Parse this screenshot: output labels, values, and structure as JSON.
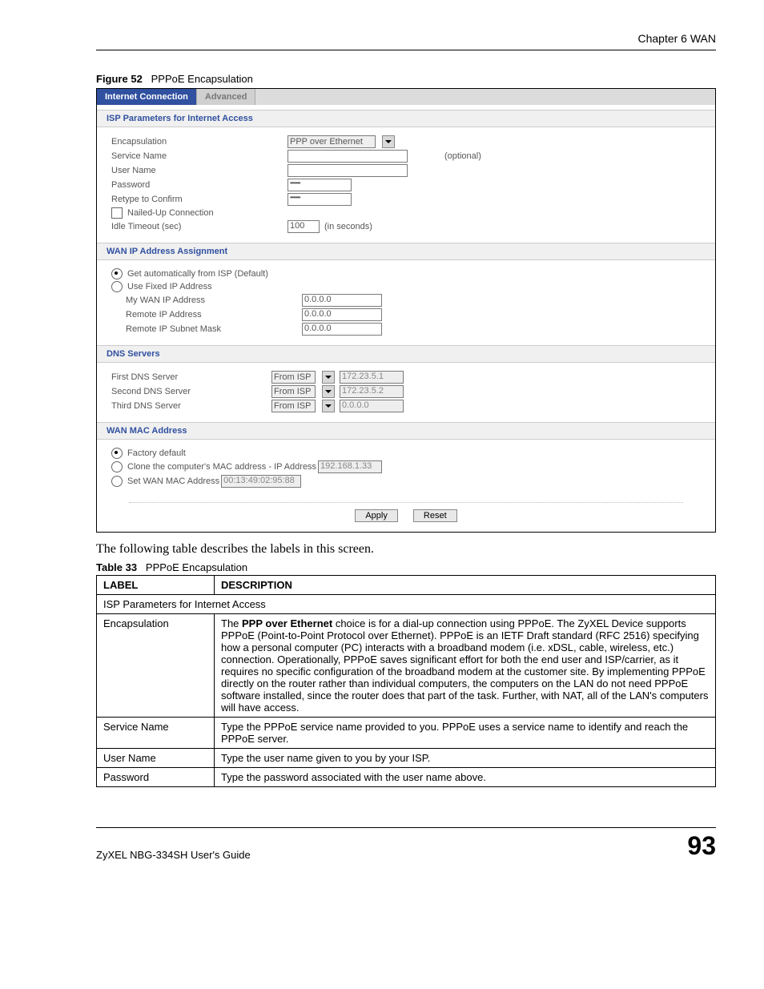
{
  "header": {
    "chapter": "Chapter 6 WAN"
  },
  "figure": {
    "label": "Figure 52",
    "title": "PPPoE Encapsulation"
  },
  "ui": {
    "tabs": {
      "active": "Internet Connection",
      "inactive": "Advanced"
    },
    "sections": {
      "isp": "ISP Parameters for Internet Access",
      "wanip": "WAN IP Address Assignment",
      "dns": "DNS Servers",
      "mac": "WAN MAC Address"
    },
    "isp": {
      "encapsulation_label": "Encapsulation",
      "encapsulation_value": "PPP over Ethernet",
      "service_name_label": "Service Name",
      "service_name_value": "",
      "service_name_hint": "(optional)",
      "user_name_label": "User Name",
      "user_name_value": "",
      "password_label": "Password",
      "password_value": "•••••••",
      "retype_label": "Retype to Confirm",
      "retype_value": "•••••••",
      "nailed_up_label": "Nailed-Up Connection",
      "idle_timeout_label": "Idle Timeout (sec)",
      "idle_timeout_value": "100",
      "idle_timeout_hint": "(in seconds)"
    },
    "wanip": {
      "auto_label": "Get automatically from ISP (Default)",
      "fixed_label": "Use Fixed IP Address",
      "my_wan_label": "My WAN IP Address",
      "my_wan_value": "0.0.0.0",
      "remote_ip_label": "Remote IP Address",
      "remote_ip_value": "0.0.0.0",
      "remote_subnet_label": "Remote IP Subnet Mask",
      "remote_subnet_value": "0.0.0.0"
    },
    "dns": {
      "first_label": "First DNS Server",
      "second_label": "Second DNS Server",
      "third_label": "Third DNS Server",
      "from_isp": "From ISP",
      "first_value": "172.23.5.1",
      "second_value": "172.23.5.2",
      "third_value": "0.0.0.0"
    },
    "mac": {
      "factory_label": "Factory default",
      "clone_label": "Clone the computer's MAC address - IP Address",
      "clone_value": "192.168.1.33",
      "set_label": "Set WAN MAC Address",
      "set_value": "00:13:49:02:95:88"
    },
    "buttons": {
      "apply": "Apply",
      "reset": "Reset"
    }
  },
  "intro": "The following table describes the labels in this screen.",
  "table": {
    "label": "Table 33",
    "title": "PPPoE Encapsulation",
    "head_label": "LABEL",
    "head_desc": "DESCRIPTION",
    "section_row": "ISP Parameters for Internet Access",
    "rows": [
      {
        "label": "Encapsulation",
        "desc_prefix": "The ",
        "desc_bold": "PPP over Ethernet",
        "desc_rest": " choice is for a dial-up connection using PPPoE. The ZyXEL Device supports PPPoE (Point-to-Point Protocol over Ethernet). PPPoE is an IETF Draft standard (RFC 2516) specifying how a personal computer (PC) interacts with a broadband modem (i.e. xDSL, cable, wireless, etc.) connection. Operationally, PPPoE saves significant effort for both the end user and ISP/carrier, as it requires no specific configuration of the broadband modem at the customer site. By implementing PPPoE directly on the router rather than individual computers, the computers on the LAN do not need PPPoE software installed, since the router does that part of the task. Further, with NAT, all of the LAN's computers will have access."
      },
      {
        "label": "Service Name",
        "desc": "Type the PPPoE service name provided to you. PPPoE uses a service name to identify and reach the PPPoE server."
      },
      {
        "label": "User Name",
        "desc": "Type the user name given to you by your ISP."
      },
      {
        "label": "Password",
        "desc": "Type the password associated with the user name above."
      }
    ]
  },
  "footer": {
    "guide": "ZyXEL NBG-334SH User's Guide",
    "page": "93"
  }
}
